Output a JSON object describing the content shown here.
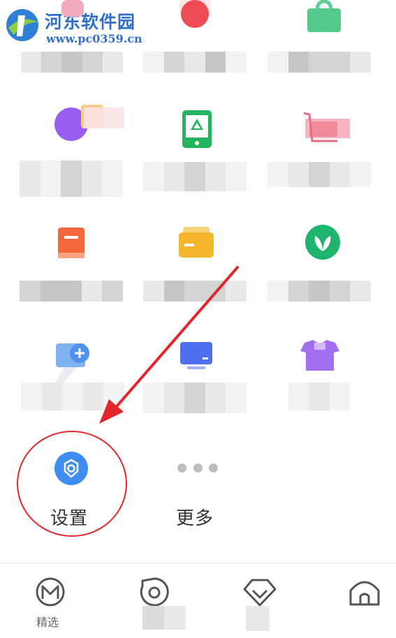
{
  "watermark": {
    "title": "河东软件园",
    "url": "www.pc0359.cn"
  },
  "grid": {
    "settings_label": "设置",
    "more_label": "更多"
  },
  "bottom_nav": {
    "featured_label": "精选"
  },
  "colors": {
    "accent": "#3f8df1",
    "annotation": "#e2262b"
  }
}
